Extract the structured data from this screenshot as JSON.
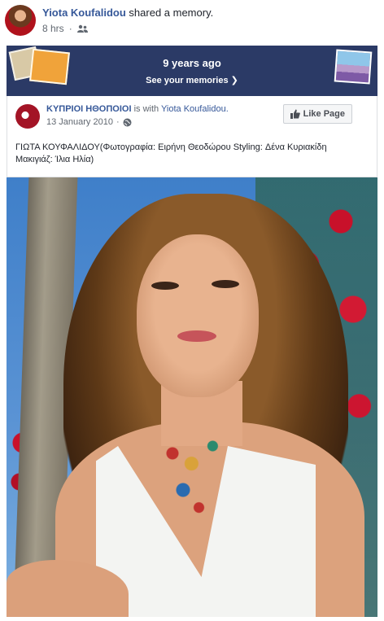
{
  "post": {
    "author": "Yiota Koufalidou",
    "action": "shared a memory.",
    "time": "8 hrs",
    "audience_icon": "friends-icon"
  },
  "memories": {
    "title": "9 years ago",
    "link": "See your memories",
    "background": "#2b3a66"
  },
  "shared": {
    "page_name": "ΚΥΠΡΙΟΙ ΗΘΟΠΟΙΟΙ",
    "with_text": "is with",
    "with_name": "Yiota Koufalidou.",
    "date": "13 January 2010",
    "privacy_icon": "globe-icon",
    "like_button": "Like Page",
    "caption": "ΓΙΩΤΑ ΚΟΥΦΑΛΙΔΟΥ(Φωτογραφία: Ειρήνη Θεοδώρου Styling: Δένα Κυριακίδη Μακιγιάζ: Ίλια Ηλία)"
  },
  "colors": {
    "link": "#365899",
    "secondary_text": "#606770",
    "text": "#1d2129"
  }
}
